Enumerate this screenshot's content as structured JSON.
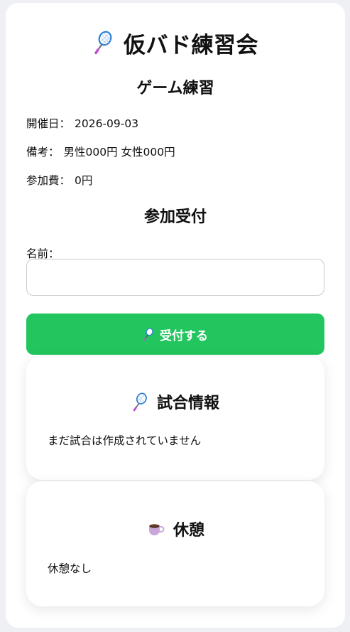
{
  "app": {
    "title": "仮バド練習会",
    "title_icon": "badminton-racket-icon"
  },
  "event": {
    "title": "ゲーム練習",
    "date_label": "開催日：",
    "date_value": "2026-09-03",
    "note_label": "備考：",
    "note_value": "男性000円 女性000円",
    "fee_label": "参加費：",
    "fee_value": "0円"
  },
  "registration": {
    "heading": "参加受付",
    "name_label": "名前：",
    "name_value": "",
    "name_placeholder": "",
    "submit_label": "受付する",
    "submit_icon": "badminton-racket-icon",
    "button_color": "#22c55e"
  },
  "match_info": {
    "heading": "試合情報",
    "icon": "badminton-racket-icon",
    "message": "まだ試合は作成されていません"
  },
  "break_info": {
    "heading": "休憩",
    "icon": "coffee-icon",
    "message": "休憩なし"
  }
}
